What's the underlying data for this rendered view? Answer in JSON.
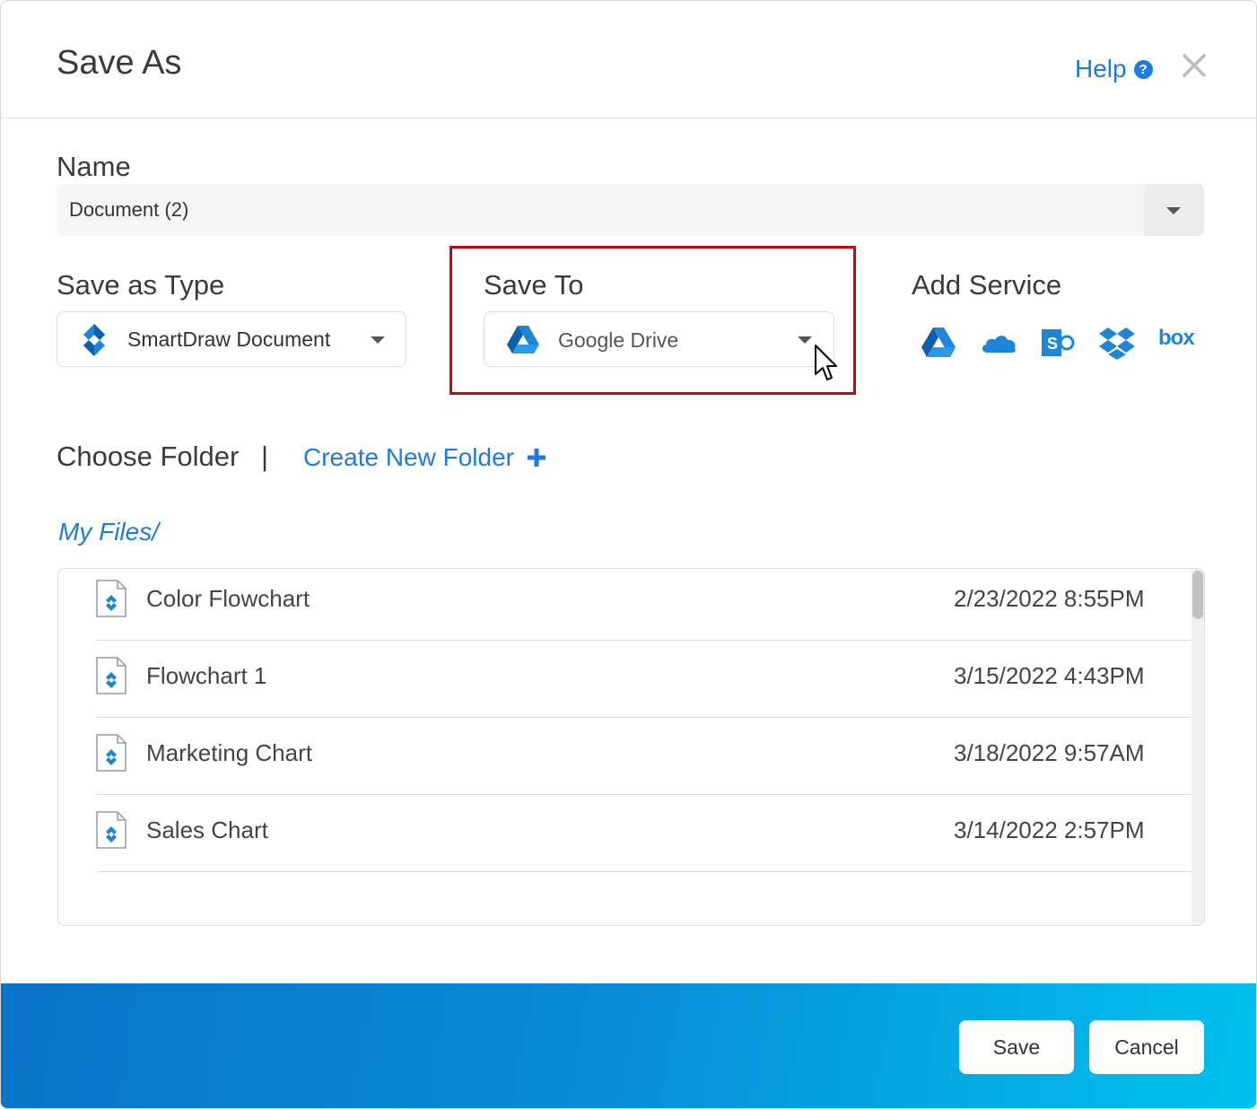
{
  "dialog": {
    "title": "Save As",
    "help_label": "Help",
    "help_icon": "question-circle-icon",
    "close_icon": "close-icon"
  },
  "name": {
    "label": "Name",
    "value": "Document (2)"
  },
  "save_as_type": {
    "label": "Save as Type",
    "selected": "SmartDraw Document",
    "icon": "smartdraw-logo-icon"
  },
  "save_to": {
    "label": "Save To",
    "selected": "Google Drive",
    "icon": "google-drive-icon"
  },
  "add_service": {
    "label": "Add Service",
    "services": [
      {
        "icon": "google-drive-icon"
      },
      {
        "icon": "onedrive-icon"
      },
      {
        "icon": "sharepoint-icon"
      },
      {
        "icon": "dropbox-icon"
      },
      {
        "icon": "box-icon",
        "text": "box"
      }
    ]
  },
  "folder": {
    "choose_label": "Choose Folder",
    "separator": "|",
    "create_label": "Create New Folder",
    "path": "My Files/"
  },
  "files": [
    {
      "name": "Color Flowchart",
      "date": "2/23/2022 8:55PM"
    },
    {
      "name": "Flowchart 1",
      "date": "3/15/2022 4:43PM"
    },
    {
      "name": "Marketing Chart",
      "date": "3/18/2022 9:57AM"
    },
    {
      "name": "Sales Chart",
      "date": "3/14/2022 2:57PM"
    }
  ],
  "footer": {
    "save_label": "Save",
    "cancel_label": "Cancel"
  },
  "colors": {
    "accent": "#1f7ae0",
    "highlight": "#c4060d",
    "footer_start": "#0a74c9",
    "footer_end": "#00c1ef"
  }
}
